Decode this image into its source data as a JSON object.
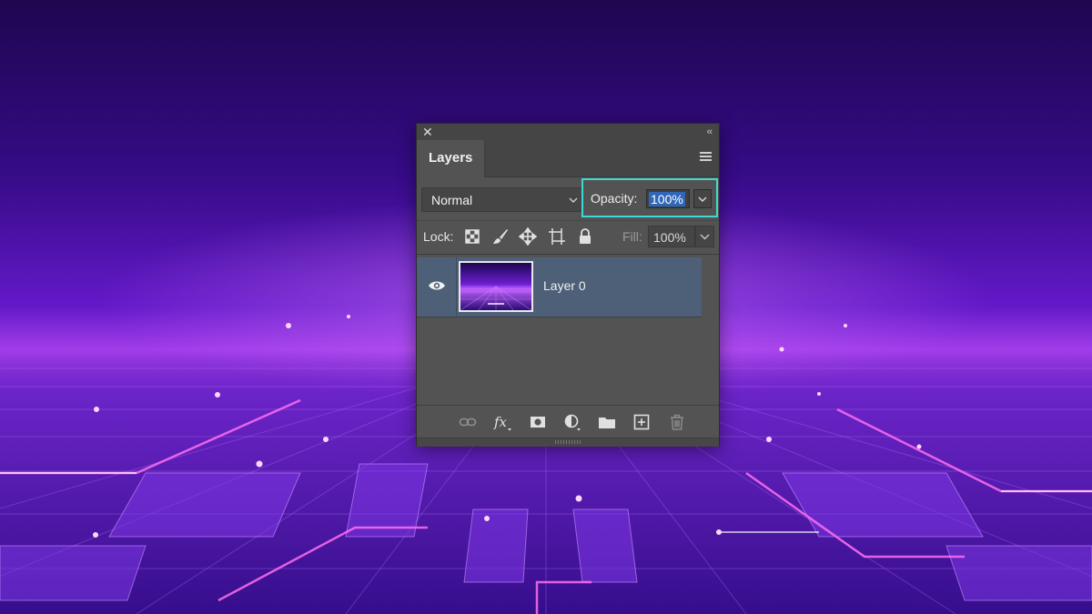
{
  "panel": {
    "tab_label": "Layers",
    "close_icon": "close-icon",
    "collapse_icon": "double-chevron-left-icon",
    "menu_icon": "panel-menu-icon"
  },
  "blend_mode": {
    "value": "Normal"
  },
  "opacity": {
    "label": "Opacity:",
    "value": "100%",
    "highlight_color": "#3fd9d3"
  },
  "lock": {
    "label": "Lock:",
    "icons": [
      "lock-transparent-pixels-icon",
      "lock-image-pixels-icon",
      "lock-position-icon",
      "lock-artboard-icon",
      "lock-all-icon"
    ]
  },
  "fill": {
    "label": "Fill:",
    "value": "100%"
  },
  "layers": [
    {
      "name": "Layer 0",
      "visible": true,
      "selected": true
    }
  ],
  "bottom_icons": [
    "link-layers-icon",
    "fx-icon",
    "layer-mask-icon",
    "adjustment-layer-icon",
    "new-group-icon",
    "new-layer-icon",
    "delete-icon"
  ],
  "colors": {
    "panel": "#535353",
    "selected_row": "#4d6078",
    "selection_text_bg": "#2f66b8"
  }
}
